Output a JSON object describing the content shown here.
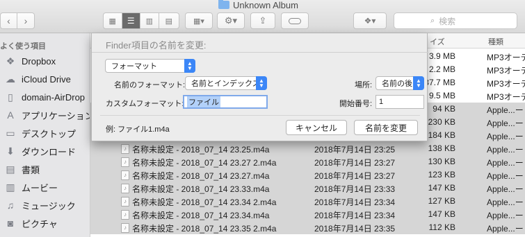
{
  "window": {
    "title": "Unknown Album"
  },
  "toolbar": {
    "search_placeholder": "検索"
  },
  "sidebar": {
    "header": "よく使う項目",
    "items": [
      {
        "label": "Dropbox",
        "icon": "dropbox-icon"
      },
      {
        "label": "iCloud Drive",
        "icon": "cloud-icon"
      },
      {
        "label": "domain-AirDrop",
        "icon": "document-icon"
      },
      {
        "label": "アプリケーション",
        "icon": "applications-icon"
      },
      {
        "label": "デスクトップ",
        "icon": "desktop-icon"
      },
      {
        "label": "ダウンロード",
        "icon": "download-icon"
      },
      {
        "label": "書類",
        "icon": "documents-icon"
      },
      {
        "label": "ムービー",
        "icon": "movie-icon"
      },
      {
        "label": "ミュージック",
        "icon": "music-icon"
      },
      {
        "label": "ピクチャ",
        "icon": "camera-icon"
      }
    ]
  },
  "list": {
    "headers": {
      "size": "イズ",
      "kind": "種類"
    },
    "rows": [
      {
        "name": "",
        "date": "",
        "size": "3.9 MB",
        "kind": "MP3オーデ",
        "selected": false
      },
      {
        "name": "",
        "date": "",
        "size": "2.2 MB",
        "kind": "MP3オーデ",
        "selected": false
      },
      {
        "name": "",
        "date": "",
        "size": "37.7 MB",
        "kind": "MP3オーデ",
        "selected": false
      },
      {
        "name": "",
        "date": "",
        "size": "9.5 MB",
        "kind": "MP3オーデ",
        "selected": false
      },
      {
        "name": "",
        "date": "",
        "size": "94 KB",
        "kind": "Apple...ー",
        "selected": true
      },
      {
        "name": "",
        "date": "",
        "size": "230 KB",
        "kind": "Apple...ー",
        "selected": true
      },
      {
        "name": "",
        "date": "",
        "size": "184 KB",
        "kind": "Apple...ー",
        "selected": true
      },
      {
        "name": "名称未設定 - 2018_07_14 23.25.m4a",
        "date": "2018年7月14日 23:25",
        "size": "138 KB",
        "kind": "Apple...ー",
        "selected": true
      },
      {
        "name": "名称未設定 - 2018_07_14 23.27 2.m4a",
        "date": "2018年7月14日 23:27",
        "size": "130 KB",
        "kind": "Apple...ー",
        "selected": true
      },
      {
        "name": "名称未設定 - 2018_07_14 23.27.m4a",
        "date": "2018年7月14日 23:27",
        "size": "123 KB",
        "kind": "Apple...ー",
        "selected": true
      },
      {
        "name": "名称未設定 - 2018_07_14 23.33.m4a",
        "date": "2018年7月14日 23:33",
        "size": "147 KB",
        "kind": "Apple...ー",
        "selected": true
      },
      {
        "name": "名称未設定 - 2018_07_14 23.34 2.m4a",
        "date": "2018年7月14日 23:34",
        "size": "127 KB",
        "kind": "Apple...ー",
        "selected": true
      },
      {
        "name": "名称未設定 - 2018_07_14 23.34.m4a",
        "date": "2018年7月14日 23:34",
        "size": "147 KB",
        "kind": "Apple...ー",
        "selected": true
      },
      {
        "name": "名称未設定 - 2018_07_14 23.35 2.m4a",
        "date": "2018年7月14日 23:35",
        "size": "112 KB",
        "kind": "Apple...ー",
        "selected": true
      }
    ]
  },
  "dialog": {
    "title": "Finder項目の名前を変更:",
    "mode_popup": "フォーマット",
    "name_format_label": "名前のフォーマット:",
    "name_format_value": "名前とインデックス",
    "location_label": "場所:",
    "location_value": "名前の後",
    "custom_format_label": "カスタムフォーマット:",
    "custom_format_value": "ファイル",
    "start_number_label": "開始番号:",
    "start_number_value": "1",
    "example_text": "例: ファイル1.m4a",
    "cancel_label": "キャンセル",
    "rename_label": "名前を変更"
  }
}
